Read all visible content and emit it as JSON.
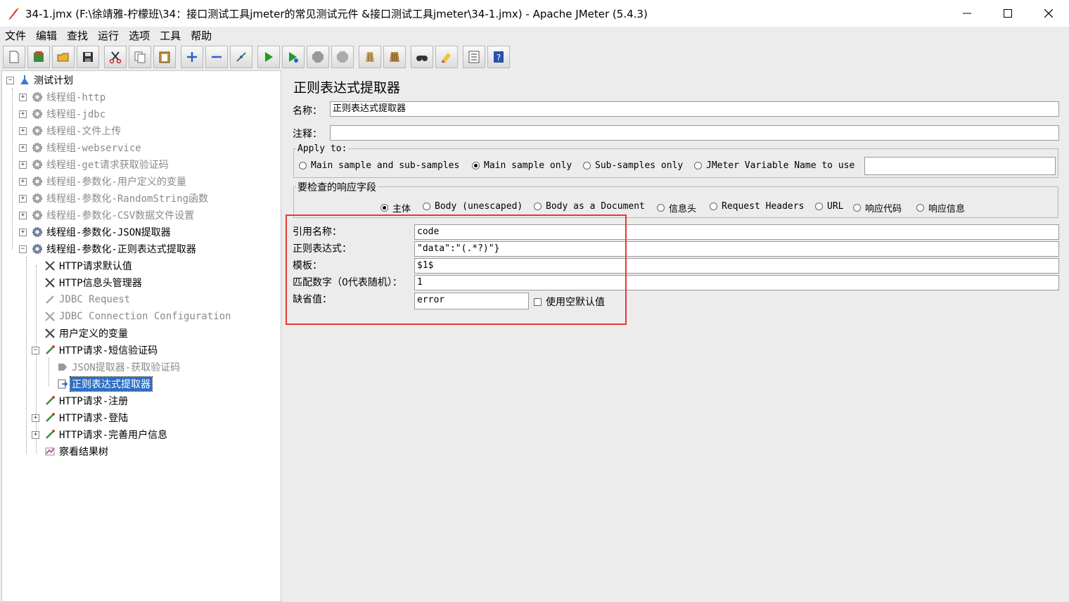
{
  "window": {
    "title": "34-1.jmx (F:\\徐靖雅-柠檬班\\34：接口测试工具jmeter的常见测试元件 &接口测试工具jmeter\\34-1.jmx) - Apache JMeter (5.4.3)",
    "minimize_icon": "minimize-icon",
    "maximize_icon": "maximize-icon",
    "close_icon": "close-icon"
  },
  "menu": [
    "文件",
    "编辑",
    "查找",
    "运行",
    "选项",
    "工具",
    "帮助"
  ],
  "toolbar": {
    "icons": [
      "new-icon",
      "templates-icon",
      "open-icon",
      "save-icon",
      "cut-icon",
      "copy-icon",
      "paste-icon",
      "expand-icon",
      "collapse-icon",
      "toggle-icon",
      "start-icon",
      "start-no-pause-icon",
      "stop-icon",
      "shutdown-icon",
      "clear-icon",
      "clear-all-icon",
      "search-icon",
      "reset-search-icon",
      "function-helper-icon",
      "help-icon"
    ]
  },
  "tree": {
    "root": "测试计划",
    "items": [
      {
        "label": "线程组-http",
        "disabled": true
      },
      {
        "label": "线程组-jdbc",
        "disabled": true
      },
      {
        "label": "线程组-文件上传",
        "disabled": true
      },
      {
        "label": "线程组-webservice",
        "disabled": true
      },
      {
        "label": "线程组-get请求获取验证码",
        "disabled": true
      },
      {
        "label": "线程组-参数化-用户定义的变量",
        "disabled": true
      },
      {
        "label": "线程组-参数化-RandomString函数",
        "disabled": true
      },
      {
        "label": "线程组-参数化-CSV数据文件设置",
        "disabled": true
      },
      {
        "label": "线程组-参数化-JSON提取器",
        "disabled": false
      },
      {
        "label": "线程组-参数化-正则表达式提取器",
        "disabled": false
      },
      {
        "label": "HTTP请求默认值",
        "disabled": false
      },
      {
        "label": "HTTP信息头管理器",
        "disabled": false
      },
      {
        "label": "JDBC Request",
        "disabled": true
      },
      {
        "label": "JDBC Connection Configuration",
        "disabled": true
      },
      {
        "label": "用户定义的变量",
        "disabled": false
      },
      {
        "label": "HTTP请求-短信验证码",
        "disabled": false
      },
      {
        "label": "JSON提取器-获取验证码",
        "disabled": true
      },
      {
        "label": "正则表达式提取器",
        "disabled": false
      },
      {
        "label": "HTTP请求-注册",
        "disabled": false
      },
      {
        "label": "HTTP请求-登陆",
        "disabled": false
      },
      {
        "label": "HTTP请求-完善用户信息",
        "disabled": false
      },
      {
        "label": "察看结果树",
        "disabled": false
      }
    ]
  },
  "editor": {
    "title": "正则表达式提取器",
    "name_label": "名称：",
    "name_value": "正则表达式提取器",
    "comment_label": "注释：",
    "comment_value": "",
    "apply_to": {
      "title": "Apply to:",
      "options": [
        "Main sample and sub-samples",
        "Main sample only",
        "Sub-samples only",
        "JMeter Variable Name to use"
      ],
      "selected": "Main sample only",
      "variable_name_value": ""
    },
    "field_to_check": {
      "title": "要检查的响应字段",
      "options": [
        "主体",
        "Body (unescaped)",
        "Body as a Document",
        "信息头",
        "Request Headers",
        "URL",
        "响应代码",
        "响应信息"
      ],
      "selected": "主体"
    },
    "reference_name_label": "引用名称：",
    "reference_name_value": "code",
    "regex_label": "正则表达式：",
    "regex_value": "\"data\":\"(.*?)\"}",
    "template_label": "模板：",
    "template_value": "$1$",
    "match_no_label": "匹配数字（0代表随机）：",
    "match_no_value": "1",
    "default_label": "缺省值：",
    "default_value": "error",
    "use_empty_default_label": "使用空默认值",
    "use_empty_default_checked": false,
    "highlight_color": "#e53935"
  }
}
